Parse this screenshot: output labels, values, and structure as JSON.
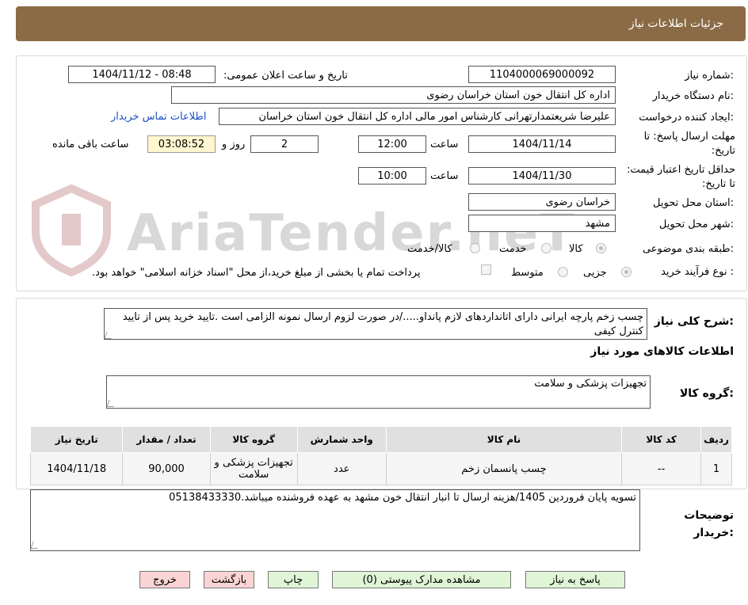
{
  "header": {
    "title": "جزئیات اطلاعات نیاز"
  },
  "watermark": {
    "text": "AriaTender.neT"
  },
  "form": {
    "need_number_label": "شماره نیاز:",
    "need_number": "1104000069000092",
    "announce_label": "تاریخ و ساعت اعلان عمومی:",
    "announce_value": "1404/11/12 - 08:48",
    "buyer_label": "نام دستگاه خریدار:",
    "buyer_value": "اداره کل انتقال خون استان خراسان رضوی",
    "creator_label": "ایجاد کننده درخواست:",
    "creator_value": "علیرضا شریعتمدارتهرانی کارشناس امور مالی اداره کل انتقال خون استان خراسان",
    "contact_link": "اطلاعات تماس خریدار",
    "deadline_label": "مهلت ارسال پاسخ: تا تاریخ:",
    "deadline_date": "1404/11/14",
    "time_label": "ساعت",
    "deadline_time": "12:00",
    "days_value": "2",
    "days_label": "روز و",
    "remaining_time": "03:08:52",
    "remaining_label": "ساعت باقی مانده",
    "validity_label": "حداقل تاریخ اعتبار قیمت: تا تاریخ:",
    "validity_date": "1404/11/30",
    "validity_time": "10:00",
    "province_label": "استان محل تحویل:",
    "province_value": "خراسان رضوی",
    "city_label": "شهر محل تحویل:",
    "city_value": "مشهد",
    "category_label": "طبقه بندی موضوعی:",
    "category_options": [
      "کالا",
      "خدمت",
      "کالا/خدمت"
    ],
    "process_label": "نوع فرآیند خرید :",
    "process_options": [
      "جزیی",
      "متوسط"
    ],
    "process_note": "پرداخت تمام یا بخشی از مبلغ خرید،از محل \"اسناد خزانه اسلامی\" خواهد بود."
  },
  "description": {
    "label": "شرح کلی نیاز:",
    "text": "چسب زخم پارچه ایرانی دارای اتانداردهای لازم پانداو...../در صورت لزوم ارسال نمونه الزامی است .تایید خرید پس از تایید کنترل کیفی"
  },
  "goods": {
    "section_title": "اطلاعات کالاهای مورد نیاز",
    "group_label": "گروه کالا:",
    "group_value": "تجهیزات پزشکی و سلامت"
  },
  "table": {
    "headers": [
      "ردیف",
      "کد کالا",
      "نام کالا",
      "واحد شمارش",
      "گروه کالا",
      "تعداد / مقدار",
      "تاریخ نیاز"
    ],
    "rows": [
      {
        "row": "1",
        "code": "--",
        "name": "چسب پانسمان زخم",
        "unit": "عدد",
        "group": "تجهیزات پزشکی و سلامت",
        "qty": "90,000",
        "date": "1404/11/18"
      }
    ]
  },
  "buyer_notes": {
    "label": "توضیحات خریدار:",
    "text": "تسویه پایان فروردین 1405/هزینه ارسال تا انبار انتقال خون مشهد به عهده فروشنده میباشد.05138433330"
  },
  "buttons": {
    "reply": "پاسخ به نیاز",
    "attachments": "مشاهده مدارک پیوستی (0)",
    "print": "چاپ",
    "back": "بازگشت",
    "exit": "خروج"
  }
}
